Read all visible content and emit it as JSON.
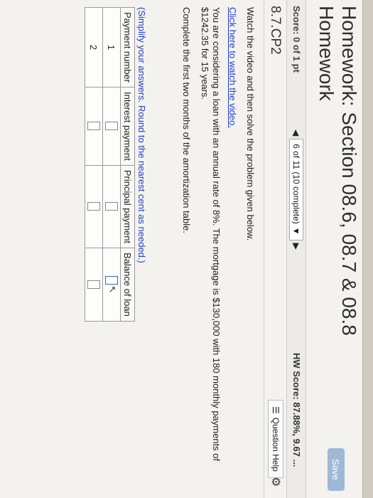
{
  "header": {
    "title": "Homework: Section 08.6, 08.7 & 08.8 Homework",
    "save_label": "Save"
  },
  "status": {
    "score": "Score: 0 of 1 pt",
    "question_select": "6 of 11 (10 complete)",
    "hw_score": "HW Score: 87.88%, 9.67 ..."
  },
  "question": {
    "id": "8.7.CP2",
    "help_label": "Question Help"
  },
  "content": {
    "instruction": "Watch the video and then solve the problem given below.",
    "video_link": "Click here to watch the video.",
    "problem_text": "You are considering a loan with an annual rate of 8%. The mortgage is $130,000 with 180 monthly payments of $1242.35 for 15 years.",
    "task": "Complete the first two months of the amortization table.",
    "note": "(Simplify your answers. Round to the nearest cent as needed.)"
  },
  "table": {
    "headers": [
      "Payment number",
      "Interest payment",
      "Principal payment",
      "Balance of loan"
    ],
    "rows": [
      {
        "payment_number": "1"
      },
      {
        "payment_number": "2"
      }
    ]
  },
  "icons": {
    "prev": "triangle-left-icon",
    "dropdown": "chevron-down-icon",
    "next": "triangle-right-icon",
    "help": "list-icon",
    "settings": "gear-icon"
  }
}
